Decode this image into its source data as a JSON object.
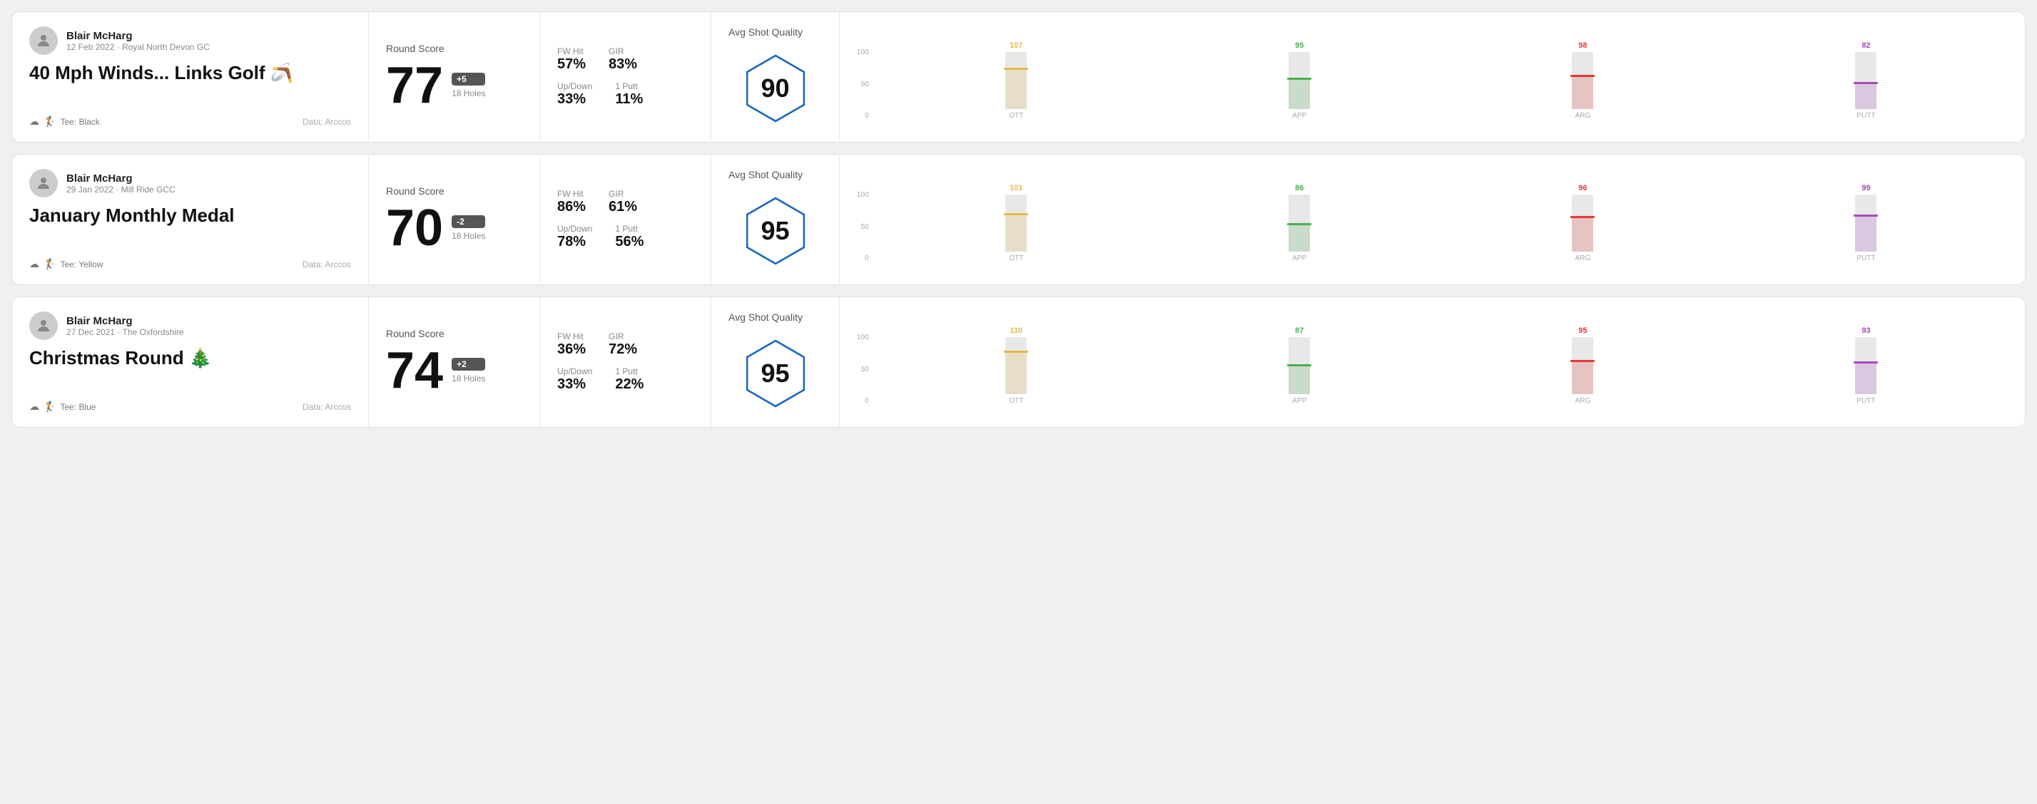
{
  "rounds": [
    {
      "id": "round1",
      "user": {
        "name": "Blair McHarg",
        "meta": "12 Feb 2022 · Royal North Devon GC"
      },
      "title": "40 Mph Winds... Links Golf 🪃",
      "tee": "Black",
      "data_source": "Data: Arccos",
      "score": {
        "label": "Round Score",
        "number": "77",
        "badge": "+5",
        "badge_type": "plus",
        "holes": "18 Holes"
      },
      "stats": {
        "fw_hit_label": "FW Hit",
        "fw_hit_value": "57%",
        "gir_label": "GIR",
        "gir_value": "83%",
        "updown_label": "Up/Down",
        "updown_value": "33%",
        "oneputt_label": "1 Putt",
        "oneputt_value": "11%"
      },
      "quality": {
        "label": "Avg Shot Quality",
        "score": "90"
      },
      "chart": {
        "bars": [
          {
            "label": "OTT",
            "value": 107,
            "color": "#e8b84b",
            "fill_pct": 72
          },
          {
            "label": "APP",
            "value": 95,
            "color": "#4caf50",
            "fill_pct": 55
          },
          {
            "label": "ARG",
            "value": 98,
            "color": "#e53935",
            "fill_pct": 60
          },
          {
            "label": "PUTT",
            "value": 82,
            "color": "#ab47bc",
            "fill_pct": 48
          }
        ],
        "y_labels": [
          "100",
          "50",
          "0"
        ]
      }
    },
    {
      "id": "round2",
      "user": {
        "name": "Blair McHarg",
        "meta": "29 Jan 2022 · Mill Ride GCC"
      },
      "title": "January Monthly Medal",
      "tee": "Yellow",
      "data_source": "Data: Arccos",
      "score": {
        "label": "Round Score",
        "number": "70",
        "badge": "-2",
        "badge_type": "minus",
        "holes": "18 Holes"
      },
      "stats": {
        "fw_hit_label": "FW Hit",
        "fw_hit_value": "86%",
        "gir_label": "GIR",
        "gir_value": "61%",
        "updown_label": "Up/Down",
        "updown_value": "78%",
        "oneputt_label": "1 Putt",
        "oneputt_value": "56%"
      },
      "quality": {
        "label": "Avg Shot Quality",
        "score": "95"
      },
      "chart": {
        "bars": [
          {
            "label": "OTT",
            "value": 101,
            "color": "#e8b84b",
            "fill_pct": 68
          },
          {
            "label": "APP",
            "value": 86,
            "color": "#4caf50",
            "fill_pct": 50
          },
          {
            "label": "ARG",
            "value": 96,
            "color": "#e53935",
            "fill_pct": 62
          },
          {
            "label": "PUTT",
            "value": 99,
            "color": "#ab47bc",
            "fill_pct": 65
          }
        ],
        "y_labels": [
          "100",
          "50",
          "0"
        ]
      }
    },
    {
      "id": "round3",
      "user": {
        "name": "Blair McHarg",
        "meta": "27 Dec 2021 · The Oxfordshire"
      },
      "title": "Christmas Round 🎄",
      "tee": "Blue",
      "data_source": "Data: Arccos",
      "score": {
        "label": "Round Score",
        "number": "74",
        "badge": "+2",
        "badge_type": "plus",
        "holes": "18 Holes"
      },
      "stats": {
        "fw_hit_label": "FW Hit",
        "fw_hit_value": "36%",
        "gir_label": "GIR",
        "gir_value": "72%",
        "updown_label": "Up/Down",
        "updown_value": "33%",
        "oneputt_label": "1 Putt",
        "oneputt_value": "22%"
      },
      "quality": {
        "label": "Avg Shot Quality",
        "score": "95"
      },
      "chart": {
        "bars": [
          {
            "label": "OTT",
            "value": 110,
            "color": "#e8b84b",
            "fill_pct": 76
          },
          {
            "label": "APP",
            "value": 87,
            "color": "#4caf50",
            "fill_pct": 52
          },
          {
            "label": "ARG",
            "value": 95,
            "color": "#e53935",
            "fill_pct": 60
          },
          {
            "label": "PUTT",
            "value": 93,
            "color": "#ab47bc",
            "fill_pct": 58
          }
        ],
        "y_labels": [
          "100",
          "50",
          "0"
        ]
      }
    }
  ]
}
